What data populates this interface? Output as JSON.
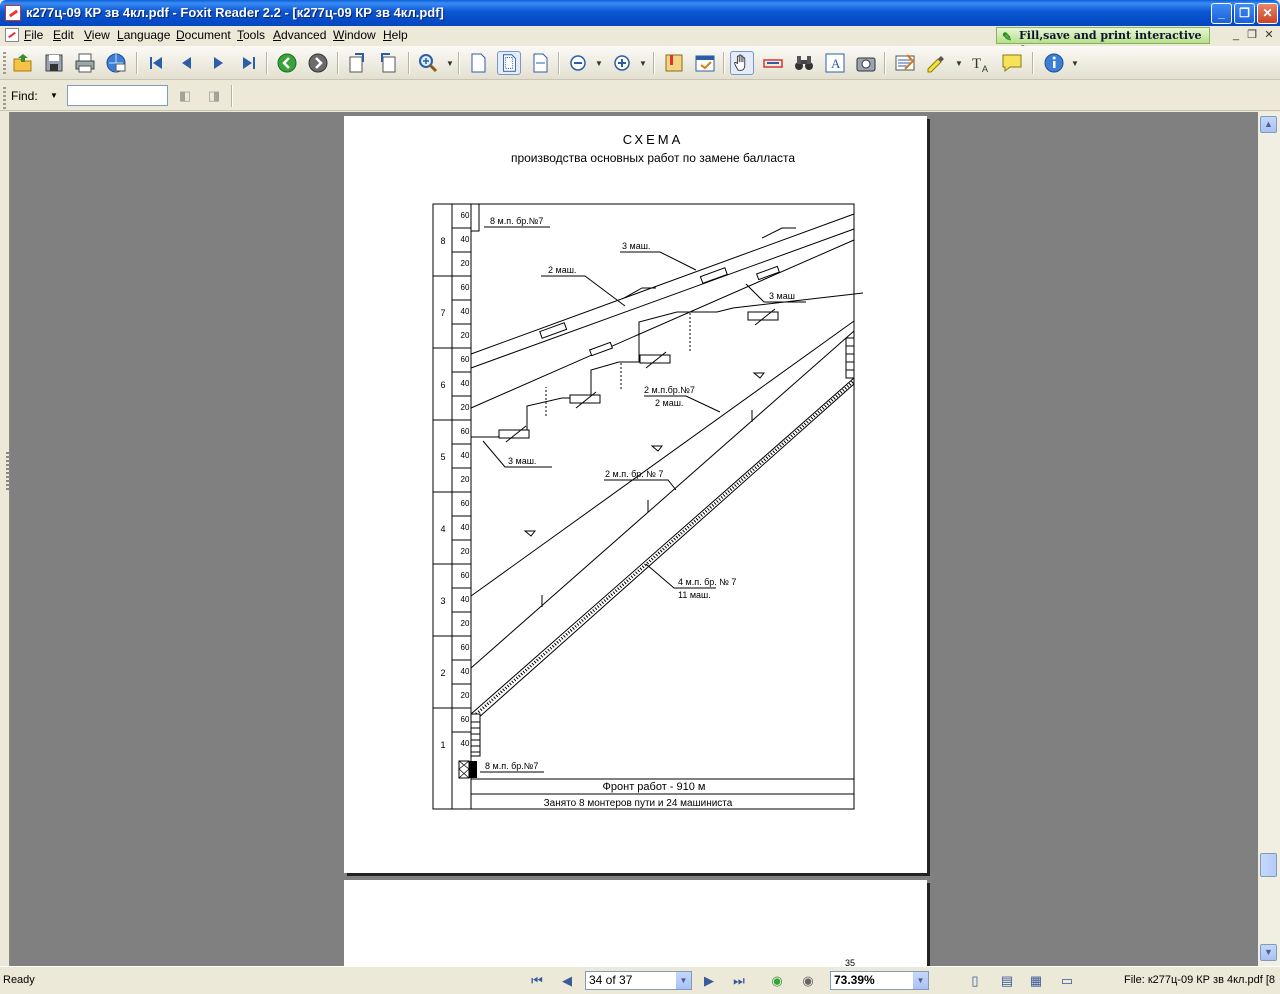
{
  "window": {
    "title": "к277ц-09 КР зв 4кл.pdf - Foxit Reader 2.2 - [к277ц-09 КР зв 4кл.pdf]",
    "minimize_glyph": "_",
    "restore_glyph": "❐",
    "close_glyph": "✕"
  },
  "menu": {
    "items": [
      {
        "underline": "F",
        "rest": "ile"
      },
      {
        "underline": "E",
        "rest": "dit"
      },
      {
        "underline": "V",
        "rest": "iew"
      },
      {
        "underline": "L",
        "rest": "anguage"
      },
      {
        "underline": "D",
        "rest": "ocument"
      },
      {
        "underline": "T",
        "rest": "ools"
      },
      {
        "underline": "A",
        "rest": "dvanced"
      },
      {
        "underline": "W",
        "rest": "indow"
      },
      {
        "underline": "H",
        "rest": "elp"
      }
    ],
    "promo": "Fill,save and print interactive forms!"
  },
  "toolbar": {
    "icons": [
      "open-icon",
      "save-icon",
      "print-icon",
      "email-icon",
      "first-page-icon",
      "prev-page-icon",
      "next-page-icon",
      "last-page-icon",
      "back-icon",
      "forward-icon",
      "rotate-left-icon",
      "rotate-right-icon",
      "zoom-in-icon",
      "actual-size-icon",
      "fit-page-icon",
      "fit-width-icon",
      "zoom-out-icon",
      "zoom-in-plus-icon",
      "bookmark-icon",
      "properties-icon",
      "hand-icon",
      "select-text-icon",
      "find-binoculars-icon",
      "text-tool-icon",
      "snapshot-icon",
      "typewriter-icon",
      "highlight-icon",
      "text-format-icon",
      "note-icon",
      "info-icon"
    ]
  },
  "find": {
    "label": "Find:",
    "value": ""
  },
  "document": {
    "title": "СХЕМА",
    "subtitle": "производства основных работ по замене балласта",
    "hour_labels": [
      "8",
      "7",
      "6",
      "5",
      "4",
      "3",
      "2",
      "1"
    ],
    "minute_labels": [
      "60",
      "40",
      "20"
    ],
    "annotations": {
      "top": "8 м.п. бр.№7",
      "three_mash_a": "3 маш.",
      "two_mash": "2 маш.",
      "three_mash_b": "3 маш",
      "two_mp": "2 м.п.бр.№7",
      "two_mash_b": "2 маш.",
      "three_mash_c": "3 маш.",
      "two_mp_b": "2 м.п. бр. № 7",
      "four_mp": "4 м.п. бр. № 7",
      "eleven_mash": "11 маш.",
      "bottom": "8 м.п. бр.№7"
    },
    "footer_front": "Фронт работ - 910 м",
    "footer_busy": "Занято  8 монтеров пути и  24 машиниста",
    "next_page_number": "35"
  },
  "statusbar": {
    "status": "Ready",
    "page": "34 of 37",
    "zoom": "73.39%",
    "file": "File: к277ц-09 КР зв 4кл.pdf [8"
  }
}
